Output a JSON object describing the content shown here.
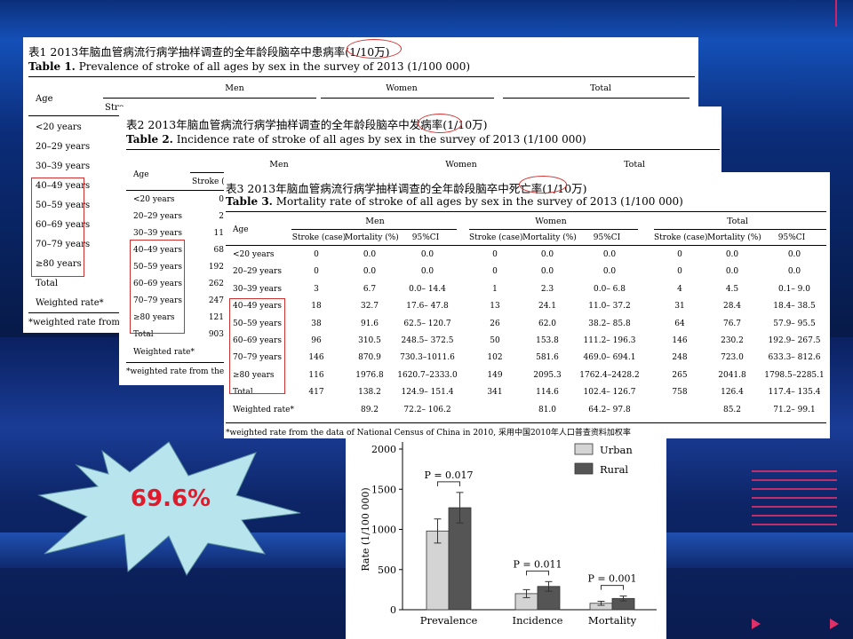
{
  "table1": {
    "caption_cn": "表1 2013年脑血管病流行病学抽样调查的全年龄段脑卒中患病率(1/10万)",
    "label": "Table 1.",
    "caption_en": "Prevalence of stroke of all ages by sex in the survey of 2013 (1/100 000)",
    "age_header": "Age",
    "groups": [
      "Men",
      "Women",
      "Total"
    ],
    "stroke_partial": "Stro",
    "ages": [
      "<20 years",
      "20–29 years",
      "30–39 years",
      "40–49 years",
      "50–59 years",
      "60–69 years",
      "70–79 years",
      "≥80 years",
      "Total",
      "Weighted rate*"
    ],
    "footnote": "*weighted rate from"
  },
  "table2": {
    "caption_cn": "表2 2013年脑血管病流行病学抽样调查的全年龄段脑卒中发病率(1/10万)",
    "label": "Table 2.",
    "caption_en": "Incidence rate of stroke of all ages by sex in the survey of 2013 (1/100 000)",
    "age_header": "Age",
    "groups": [
      "Men",
      "Women",
      "Total"
    ],
    "stroke_partial": "Stroke (c",
    "ages": [
      "<20 years",
      "20–29 years",
      "30–39 years",
      "40–49 years",
      "50–59 years",
      "60–69 years",
      "70–79 years",
      "≥80 years",
      "Total",
      "Weighted rate*"
    ],
    "stroke_values": [
      "0",
      "2",
      "11",
      "68",
      "192",
      "262",
      "247",
      "121",
      "903"
    ],
    "footnote": "*weighted rate from the"
  },
  "table3": {
    "caption_cn": "表3 2013年脑血管病流行病学抽样调查的全年龄段脑卒中死亡率(1/10万)",
    "label": "Table 3.",
    "caption_en": "Mortality rate of stroke of all ages by sex in the survey of 2013 (1/100 000)",
    "age_header": "Age",
    "groups": [
      "Men",
      "Women",
      "Total"
    ],
    "subheaders": [
      "Stroke (case)",
      "Mortality (%)",
      "95%CI"
    ],
    "rows": [
      {
        "age": "<20 years",
        "m": [
          "0",
          "0.0",
          "0.0"
        ],
        "w": [
          "0",
          "0.0",
          "0.0"
        ],
        "t": [
          "0",
          "0.0",
          "0.0"
        ]
      },
      {
        "age": "20–29 years",
        "m": [
          "0",
          "0.0",
          "0.0"
        ],
        "w": [
          "0",
          "0.0",
          "0.0"
        ],
        "t": [
          "0",
          "0.0",
          "0.0"
        ]
      },
      {
        "age": "30–39 years",
        "m": [
          "3",
          "6.7",
          "0.0– 14.4"
        ],
        "w": [
          "1",
          "2.3",
          "0.0– 6.8"
        ],
        "t": [
          "4",
          "4.5",
          "0.1– 9.0"
        ]
      },
      {
        "age": "40–49 years",
        "m": [
          "18",
          "32.7",
          "17.6– 47.8"
        ],
        "w": [
          "13",
          "24.1",
          "11.0– 37.2"
        ],
        "t": [
          "31",
          "28.4",
          "18.4– 38.5"
        ]
      },
      {
        "age": "50–59 years",
        "m": [
          "38",
          "91.6",
          "62.5– 120.7"
        ],
        "w": [
          "26",
          "62.0",
          "38.2– 85.8"
        ],
        "t": [
          "64",
          "76.7",
          "57.9– 95.5"
        ]
      },
      {
        "age": "60–69 years",
        "m": [
          "96",
          "310.5",
          "248.5– 372.5"
        ],
        "w": [
          "50",
          "153.8",
          "111.2– 196.3"
        ],
        "t": [
          "146",
          "230.2",
          "192.9– 267.5"
        ]
      },
      {
        "age": "70–79 years",
        "m": [
          "146",
          "870.9",
          "730.3–1011.6"
        ],
        "w": [
          "102",
          "581.6",
          "469.0– 694.1"
        ],
        "t": [
          "248",
          "723.0",
          "633.3– 812.6"
        ]
      },
      {
        "age": "≥80 years",
        "m": [
          "116",
          "1976.8",
          "1620.7–2333.0"
        ],
        "w": [
          "149",
          "2095.3",
          "1762.4–2428.2"
        ],
        "t": [
          "265",
          "2041.8",
          "1798.5–2285.1"
        ]
      },
      {
        "age": "Total",
        "m": [
          "417",
          "138.2",
          "124.9– 151.4"
        ],
        "w": [
          "341",
          "114.6",
          "102.4– 126.7"
        ],
        "t": [
          "758",
          "126.4",
          "117.4– 135.4"
        ]
      },
      {
        "age": "Weighted rate*",
        "m": [
          "",
          "89.2",
          "72.2– 106.2"
        ],
        "w": [
          "",
          "81.0",
          "64.2– 97.8"
        ],
        "t": [
          "",
          "85.2",
          "71.2– 99.1"
        ]
      }
    ],
    "footnote": "*weighted rate from the data of National Census of China in 2010, 采用中国2010年人口普查资料加权率"
  },
  "highlight": {
    "value": "69.6%",
    "color": "#e01a2a",
    "burst_color": "#b8e4ee"
  },
  "chart_data": {
    "type": "bar",
    "categories": [
      "Prevalence",
      "Incidence",
      "Mortality"
    ],
    "series": [
      {
        "name": "Urban",
        "color": "#d4d4d4",
        "values": [
          980,
          200,
          80
        ],
        "err": [
          150,
          50,
          25
        ]
      },
      {
        "name": "Rural",
        "color": "#555555",
        "values": [
          1270,
          290,
          140
        ],
        "err": [
          190,
          60,
          30
        ]
      }
    ],
    "pvalues": [
      "P = 0.017",
      "P = 0.011",
      "P = 0.001"
    ],
    "ylabel": "Rate (1/100 000)",
    "yticks": [
      "0",
      "500",
      "1000",
      "1500",
      "2000"
    ],
    "ylim": [
      0,
      2000
    ],
    "legend": "top-right"
  }
}
